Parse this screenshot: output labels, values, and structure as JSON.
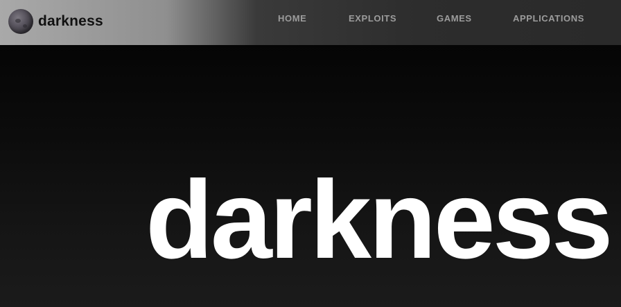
{
  "header": {
    "brand_name": "darkness",
    "logo_icon": "moon-icon"
  },
  "nav": {
    "items": [
      {
        "label": "HOME"
      },
      {
        "label": "EXPLOITS"
      },
      {
        "label": "GAMES"
      },
      {
        "label": "APPLICATIONS"
      }
    ]
  },
  "hero": {
    "title": "darkness"
  },
  "colors": {
    "background": "#131313",
    "hero_text": "#ffffff",
    "nav_text": "#9c9c9c",
    "brand_text": "#111111"
  }
}
